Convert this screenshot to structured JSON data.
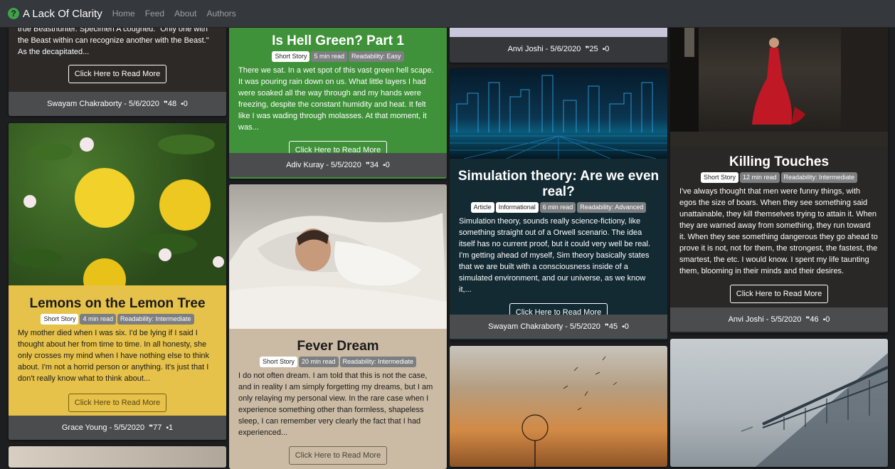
{
  "nav": {
    "brand": "A Lack Of Clarity",
    "links": [
      "Home",
      "Feed",
      "About",
      "Authors"
    ]
  },
  "common": {
    "read_more": "Click Here to Read More",
    "quote_icon": "❞",
    "comment_icon": "▪"
  },
  "cards": {
    "beast": {
      "excerpt": "true Beasthunter. Specimen A coughed. \"Only one with the Beast within can recognize another with the Beast.\" As the decapitated...",
      "author": "Swayam Chakraborty",
      "date": "5/6/2020",
      "quotes": "48",
      "comments": "0"
    },
    "hell": {
      "title": "Is Hell Green? Part 1",
      "badges": [
        "Short Story",
        "5 min read",
        "Readability: Easy"
      ],
      "excerpt": "There we sat. In a wet spot of this vast green hell scape. It was pouring rain down on us. What little layers I had were soaked all the way through and my hands were freezing, despite the constant humidity and heat. It felt like I was wading through molasses. At that moment, it was...",
      "author": "Adiv Kuray",
      "date": "5/5/2020",
      "quotes": "34",
      "comments": "0"
    },
    "anvi_top": {
      "author": "Anvi Joshi",
      "date": "5/6/2020",
      "quotes": "25",
      "comments": "0"
    },
    "lemons": {
      "title": "Lemons on the Lemon Tree",
      "badges": [
        "Short Story",
        "4 min read",
        "Readability: Intermediate"
      ],
      "excerpt": "My mother died when I was six. I'd be lying if I said I thought about her from time to time. In all honesty, she only crosses my mind when I have nothing else to think about. I'm not a horrid person or anything. It's just that I don't really know what to think about...",
      "author": "Grace Young",
      "date": "5/5/2020",
      "quotes": "77",
      "comments": "1"
    },
    "fever": {
      "title": "Fever Dream",
      "badges": [
        "Short Story",
        "20 min read",
        "Readability: Intermediate"
      ],
      "excerpt": "I do not often dream. I am told that this is not the case, and in reality I am simply forgetting my dreams, but I am only relaying my personal view. In the rare case when I experience something other than formless, shapeless sleep, I can remember very clearly the fact that I had experienced..."
    },
    "sim": {
      "title": "Simulation theory: Are we even real?",
      "badges": [
        "Article",
        "Informational",
        "6 min read",
        "Readability: Advanced"
      ],
      "excerpt": "Simulation theory, sounds really science-fictiony, like something straight out of a Orwell scenario. The idea itself has no current proof, but it could very well be real. I'm getting ahead of myself, Sim theory basically states that we are built with a consciousness inside of a simulated environment, and our universe, as we know it,...",
      "author": "Swayam Chakraborty",
      "date": "5/5/2020",
      "quotes": "45",
      "comments": "0"
    },
    "killing": {
      "title": "Killing Touches",
      "badges": [
        "Short Story",
        "12 min read",
        "Readability: Intermediate"
      ],
      "excerpt": "I've always thought that men were funny things, with egos the size of boars. When they see something said unattainable, they kill themselves trying to attain it. When they are warned away from something, they run toward it. When they see something dangerous they go ahead to prove it is not, not for them, the strongest, the fastest, the smartest, the etc. I would know. I spent my life taunting them, blooming in their minds and their desires.",
      "author": "Anvi Joshi",
      "date": "5/5/2020",
      "quotes": "46",
      "comments": "0"
    }
  }
}
